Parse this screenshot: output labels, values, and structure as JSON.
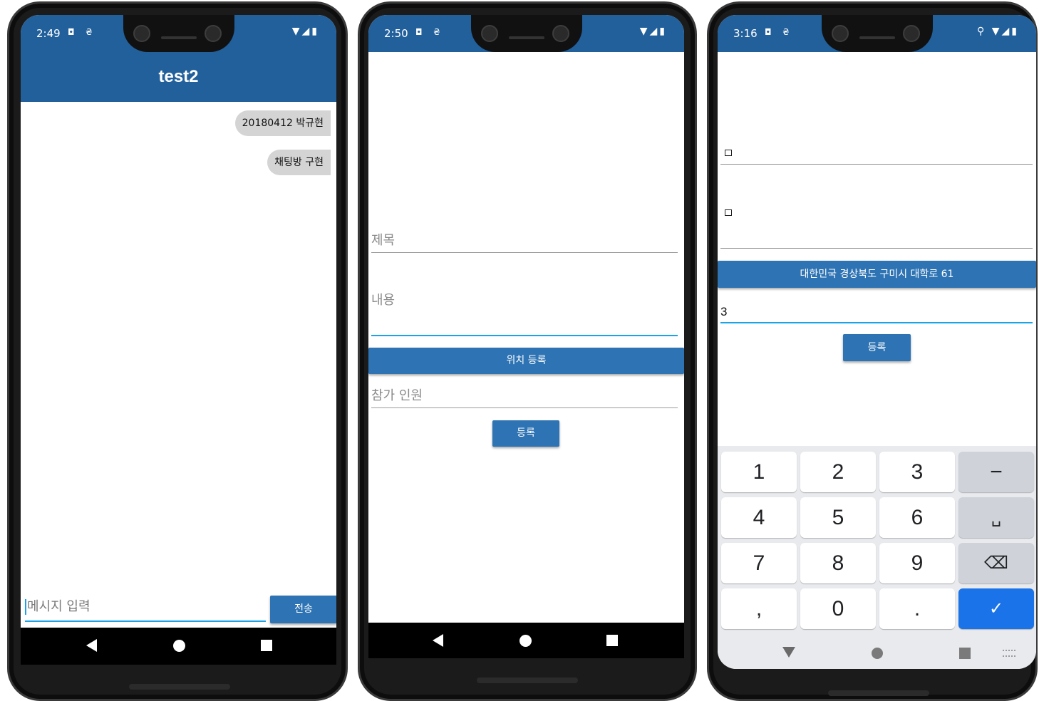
{
  "phone1": {
    "status": {
      "time": "2:49",
      "left_icons": "◘ ₴",
      "right_icons": "▼◢▮"
    },
    "appbar_title": "test2",
    "messages": [
      "20180412 박규현",
      "채팅방 구현"
    ],
    "input_placeholder": "메시지 입력",
    "send_label": "전송"
  },
  "phone2": {
    "status": {
      "time": "2:50",
      "left_icons": "◘ ₴",
      "right_icons": "▼◢▮"
    },
    "title_placeholder": "제목",
    "content_placeholder": "내용",
    "location_button": "위치 등록",
    "participants_placeholder": "참가 인원",
    "register_button": "등록"
  },
  "phone3": {
    "status": {
      "time": "3:16",
      "left_icons": "◘ ₴",
      "right_icons": "⚲ ▼◢▮"
    },
    "address_button": "대한민국 경상북도 구미시 대학로 61",
    "participants_value": "3",
    "register_button": "등록",
    "keyboard": {
      "row1": [
        "1",
        "2",
        "3",
        "−"
      ],
      "row2": [
        "4",
        "5",
        "6",
        "␣"
      ],
      "row3": [
        "7",
        "8",
        "9",
        "⌫"
      ],
      "row4": [
        ",",
        "0",
        ".",
        "✓"
      ]
    }
  }
}
